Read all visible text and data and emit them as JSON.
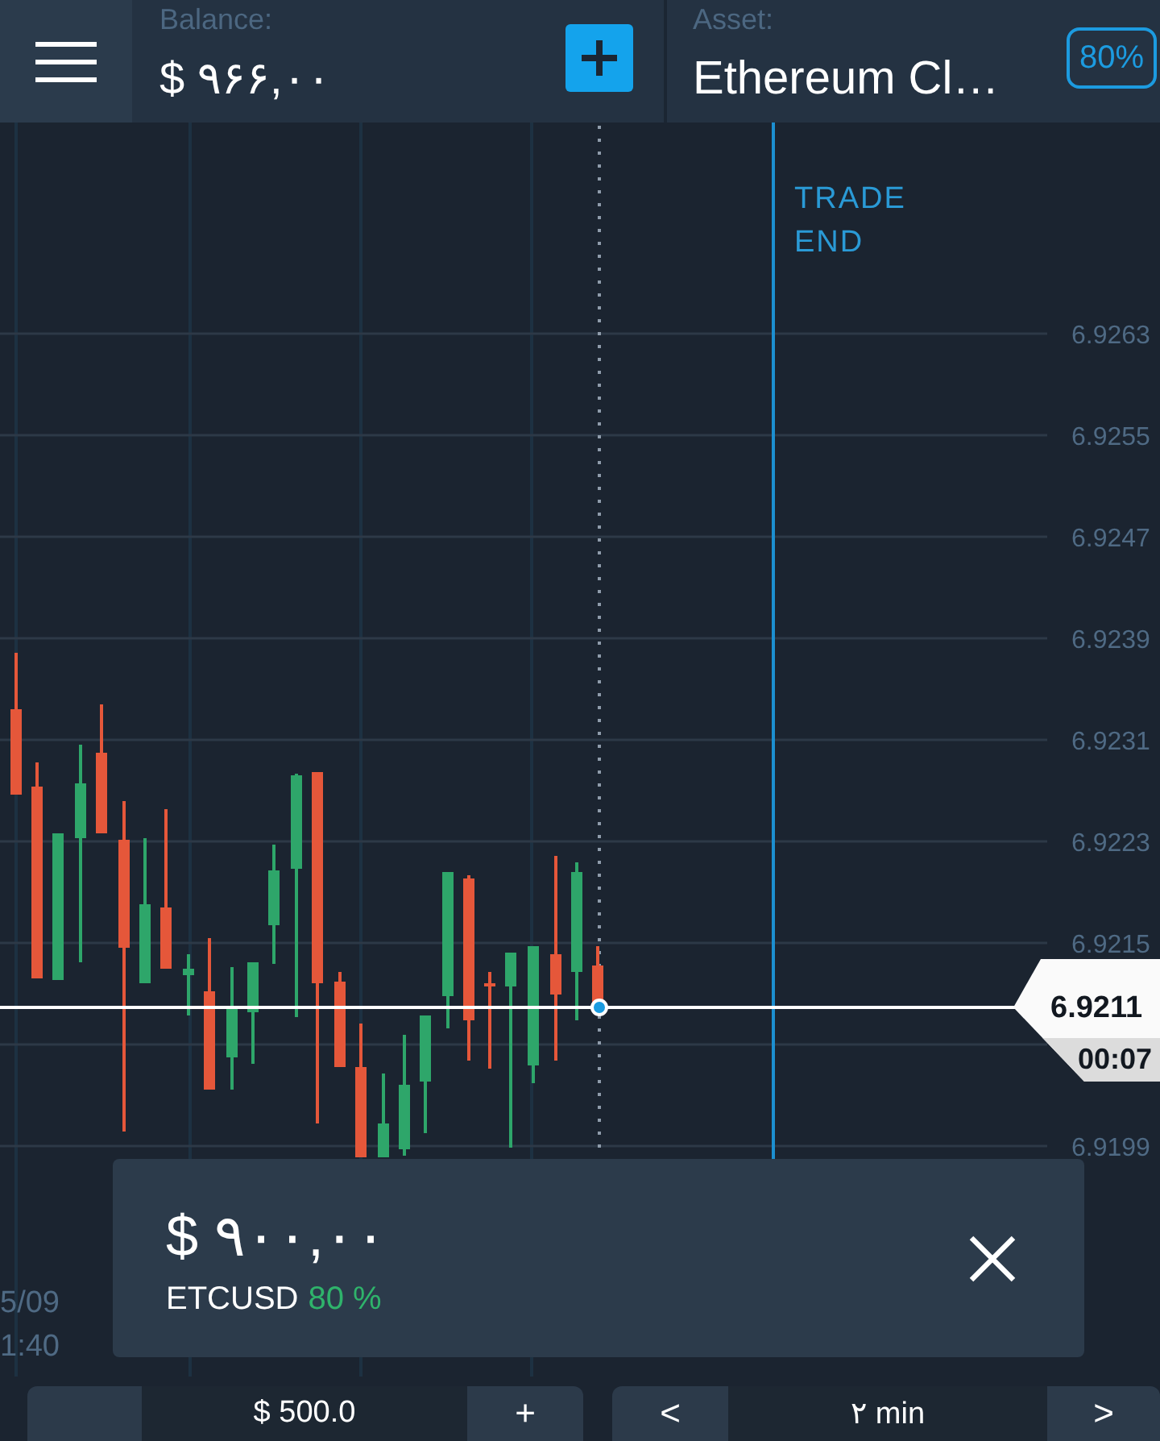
{
  "top_bar": {
    "balance": {
      "label": "Balance:",
      "value": "$ ۹۶۶,۰۰"
    },
    "asset": {
      "label": "Asset:",
      "name": "Ethereum Cl…",
      "payout": "80%"
    }
  },
  "chart": {
    "price_labels": [
      "6.9263",
      "6.9255",
      "6.9247",
      "6.9239",
      "6.9231",
      "6.9223",
      "6.9215",
      "6.9199"
    ],
    "trade_end_label": "TRADE END",
    "current_price": {
      "price": "6.9211",
      "countdown": "00:07"
    },
    "time_label": {
      "date": "5/09",
      "time": "1:40"
    }
  },
  "trade_card": {
    "amount": "$ ۹۰۰,۰۰",
    "symbol": "ETCUSD",
    "payout": "80 %"
  },
  "controls": {
    "amount": {
      "value": "$ 500.0",
      "increase": "+"
    },
    "duration": {
      "previous": "<",
      "value": "۲ min",
      "next": ">"
    }
  }
}
